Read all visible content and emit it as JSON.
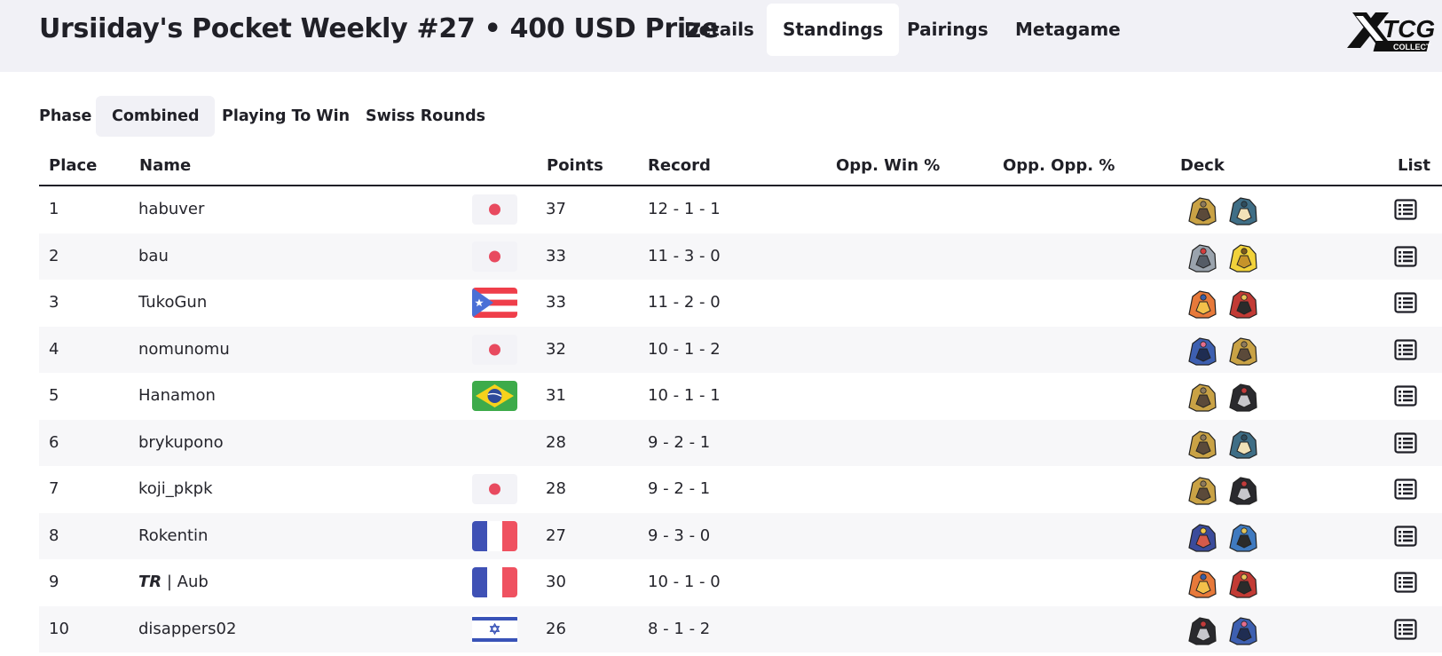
{
  "header": {
    "title": "Ursiiday's Pocket Weekly #27 • 400 USD Prize",
    "tabs": [
      {
        "label": "Details",
        "active": false
      },
      {
        "label": "Standings",
        "active": true
      },
      {
        "label": "Pairings",
        "active": false
      },
      {
        "label": "Metagame",
        "active": false
      }
    ],
    "logo_text": "LIMITLESS TCG"
  },
  "phase": {
    "label": "Phase",
    "options": [
      {
        "label": "Combined",
        "active": true
      },
      {
        "label": "Playing To Win",
        "active": false
      },
      {
        "label": "Swiss Rounds",
        "active": false
      }
    ]
  },
  "table": {
    "columns": [
      "Place",
      "Name",
      "Points",
      "Record",
      "Opp. Win %",
      "Opp. Opp. %",
      "Deck",
      "List"
    ],
    "rows": [
      {
        "place": "1",
        "team": "",
        "name": "habuver",
        "flag": "jp",
        "points": "37",
        "record": "12 - 1 - 1",
        "deck": [
          "giratina-icon",
          "snorlax-icon"
        ]
      },
      {
        "place": "2",
        "team": "",
        "name": "bau",
        "flag": "jp",
        "points": "33",
        "record": "11 - 3 - 0",
        "deck": [
          "magnezone-icon",
          "pikachu-icon"
        ]
      },
      {
        "place": "3",
        "team": "",
        "name": "TukoGun",
        "flag": "pr",
        "points": "33",
        "record": "11 - 2 - 0",
        "deck": [
          "charizard-icon",
          "incineroar-icon"
        ]
      },
      {
        "place": "4",
        "team": "",
        "name": "nomunomu",
        "flag": "jp",
        "points": "32",
        "record": "10 - 1 - 2",
        "deck": [
          "greninja-icon",
          "giratina-icon"
        ]
      },
      {
        "place": "5",
        "team": "",
        "name": "Hanamon",
        "flag": "br",
        "points": "31",
        "record": "10 - 1 - 1",
        "deck": [
          "giratina-icon",
          "darkrai-icon"
        ]
      },
      {
        "place": "6",
        "team": "",
        "name": "brykupono",
        "flag": "",
        "points": "28",
        "record": "9 - 2 - 1",
        "deck": [
          "giratina-icon",
          "snorlax-icon"
        ]
      },
      {
        "place": "7",
        "team": "",
        "name": "koji_pkpk",
        "flag": "jp",
        "points": "28",
        "record": "9 - 2 - 1",
        "deck": [
          "giratina-icon",
          "darkrai-icon"
        ]
      },
      {
        "place": "8",
        "team": "",
        "name": "Rokentin",
        "flag": "fr",
        "points": "27",
        "record": "9 - 3 - 0",
        "deck": [
          "garchomp-icon",
          "lucario-icon"
        ]
      },
      {
        "place": "9",
        "team": "TR",
        "name": " | Aub",
        "flag": "fr",
        "points": "30",
        "record": "10 - 1 - 0",
        "deck": [
          "charizard-icon",
          "incineroar-icon"
        ]
      },
      {
        "place": "10",
        "team": "",
        "name": "disappers02",
        "flag": "il",
        "points": "26",
        "record": "8 - 1 - 2",
        "deck": [
          "darkrai-icon",
          "greninja-icon"
        ]
      }
    ]
  },
  "colors": {
    "header_bg": "#f1f1f6",
    "row_alt": "#f7f7f9",
    "text": "#202027",
    "jp_red": "#e84a5f",
    "fr_blue": "#3f51b5",
    "fr_red": "#ef5160",
    "br_green": "#3dab4a"
  }
}
